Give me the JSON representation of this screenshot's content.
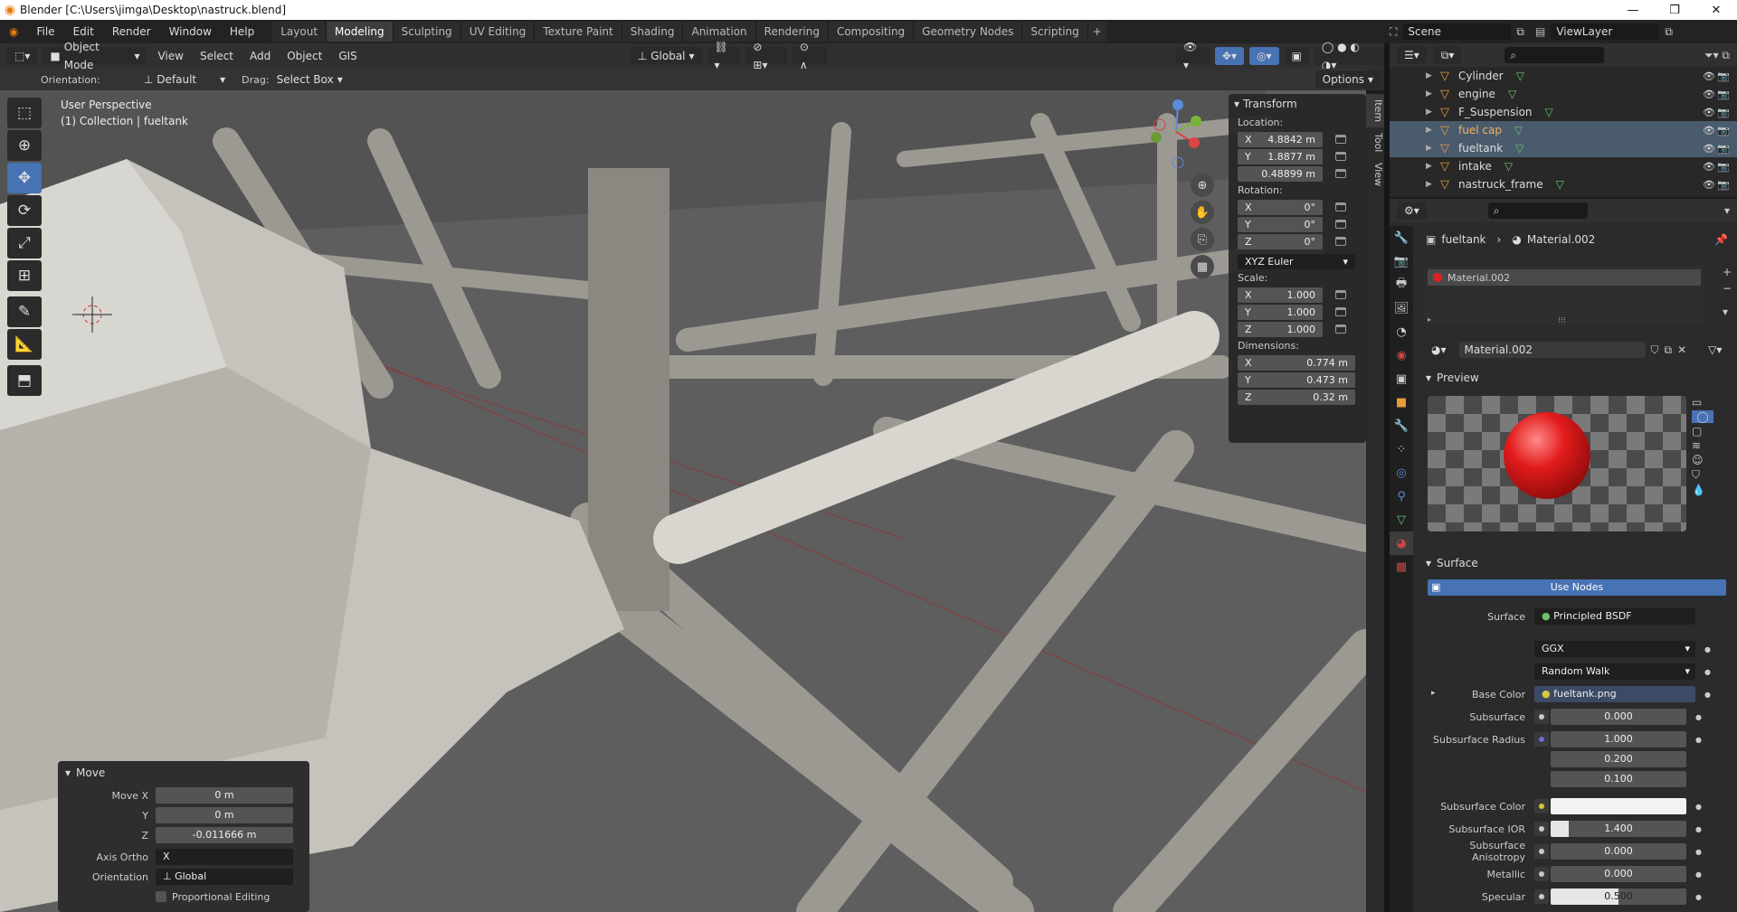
{
  "titlebar": {
    "title": "Blender [C:\\Users\\jimga\\Desktop\\nastruck.blend]"
  },
  "menu": [
    "File",
    "Edit",
    "Render",
    "Window",
    "Help"
  ],
  "workspaces": [
    "Layout",
    "Modeling",
    "Sculpting",
    "UV Editing",
    "Texture Paint",
    "Shading",
    "Animation",
    "Rendering",
    "Compositing",
    "Geometry Nodes",
    "Scripting"
  ],
  "active_workspace": "Modeling",
  "scene": {
    "scene": "Scene",
    "view_layer": "ViewLayer"
  },
  "viewport_header": {
    "mode": "Object Mode",
    "menus": [
      "View",
      "Select",
      "Add",
      "Object",
      "GIS"
    ],
    "transform": "Global"
  },
  "tool_header": {
    "orientation_label": "Orientation:",
    "orientation": "Default",
    "drag_label": "Drag:",
    "drag": "Select Box",
    "options": "Options"
  },
  "viewport": {
    "line1": "User Perspective",
    "line2": "(1) Collection | fueltank"
  },
  "npanel": {
    "title": "Transform",
    "location_label": "Location:",
    "location": [
      {
        "axis": "X",
        "value": "4.8842 m"
      },
      {
        "axis": "Y",
        "value": "1.8877 m"
      },
      {
        "axis": "",
        "value": "0.48899 m"
      }
    ],
    "rotation_label": "Rotation:",
    "rotation": [
      {
        "axis": "X",
        "value": "0°"
      },
      {
        "axis": "Y",
        "value": "0°"
      },
      {
        "axis": "Z",
        "value": "0°"
      }
    ],
    "rotation_mode": "XYZ Euler",
    "scale_label": "Scale:",
    "scale": [
      {
        "axis": "X",
        "value": "1.000"
      },
      {
        "axis": "Y",
        "value": "1.000"
      },
      {
        "axis": "Z",
        "value": "1.000"
      }
    ],
    "dimensions_label": "Dimensions:",
    "dimensions": [
      {
        "axis": "X",
        "value": "0.774 m"
      },
      {
        "axis": "Y",
        "value": "0.473 m"
      },
      {
        "axis": "Z",
        "value": "0.32 m"
      }
    ]
  },
  "sidetabs": [
    "Item",
    "Tool",
    "View"
  ],
  "move_panel": {
    "title": "Move",
    "rows": [
      {
        "label": "Move X",
        "value": "0 m"
      },
      {
        "label": "Y",
        "value": "0 m"
      },
      {
        "label": "Z",
        "value": "-0.011666 m"
      }
    ],
    "axis_ortho_label": "Axis Ortho",
    "axis_ortho": "X",
    "orientation_label": "Orientation",
    "orientation": "Global",
    "prop_edit": "Proportional Editing"
  },
  "outliner": {
    "items": [
      {
        "name": "Cylinder",
        "selected": false
      },
      {
        "name": "engine",
        "selected": false
      },
      {
        "name": "F_Suspension",
        "selected": false
      },
      {
        "name": "fuel cap",
        "selected": true
      },
      {
        "name": "fueltank",
        "selected": true
      },
      {
        "name": "intake",
        "selected": false
      },
      {
        "name": "nastruck_frame",
        "selected": false
      }
    ]
  },
  "properties": {
    "breadcrumb_object": "fueltank",
    "breadcrumb_material": "Material.002",
    "slot": "Material.002",
    "material_name": "Material.002",
    "preview_label": "Preview",
    "surface_label": "Surface",
    "use_nodes": "Use Nodes",
    "surface_shader_label": "Surface",
    "surface_shader": "Principled BSDF",
    "distribution": "GGX",
    "subsurface_method": "Random Walk",
    "base_color_label": "Base Color",
    "base_color": "fueltank.png",
    "subsurface_label": "Subsurface",
    "subsurface": "0.000",
    "subsurface_radius_label": "Subsurface Radius",
    "subsurface_radius": [
      "1.000",
      "0.200",
      "0.100"
    ],
    "subsurface_color_label": "Subsurface Color",
    "subsurface_ior_label": "Subsurface IOR",
    "subsurface_ior": "1.400",
    "subsurface_aniso_label": "Subsurface Anisotropy",
    "subsurface_aniso": "0.000",
    "metallic_label": "Metallic",
    "metallic": "0.000",
    "specular_label": "Specular",
    "specular": "0.500",
    "specular_fill": 0.5
  },
  "colors": {
    "accent": "#4772b3",
    "selected_row": "#4b5b6e",
    "object_orange": "#e89a3b"
  }
}
